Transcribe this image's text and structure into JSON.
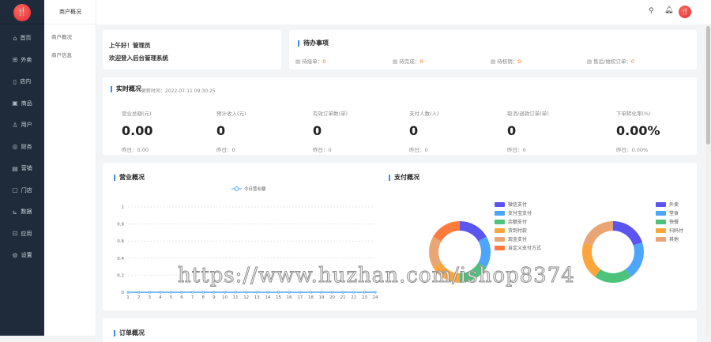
{
  "sidebar": {
    "logo": "🍴",
    "items": [
      {
        "icon": "⌂",
        "label": "首页"
      },
      {
        "icon": "⊞",
        "label": "外卖"
      },
      {
        "icon": "▯",
        "label": "店内"
      },
      {
        "icon": "▣",
        "label": "商品"
      },
      {
        "icon": "♙",
        "label": "用户"
      },
      {
        "icon": "◎",
        "label": "财务"
      },
      {
        "icon": "▤",
        "label": "营销"
      },
      {
        "icon": "▢",
        "label": "门店"
      },
      {
        "icon": "⊾",
        "label": "数据"
      },
      {
        "icon": "⊡",
        "label": "应用"
      },
      {
        "icon": "⚙",
        "label": "设置"
      }
    ]
  },
  "subnav": {
    "title": "商户概况",
    "items": [
      "商户概况",
      "商户信息"
    ]
  },
  "topbar": {
    "search_icon": "search",
    "bell_icon": "bell",
    "avatar": "🍴"
  },
  "greeting": {
    "line1": "上午好！管理员",
    "line2": "欢迎登入后台管理系统"
  },
  "todo": {
    "title": "待办事项",
    "items": [
      {
        "label": "待接单：",
        "value": "0"
      },
      {
        "label": "待完成：",
        "value": "0"
      },
      {
        "label": "待核销：",
        "value": "0"
      },
      {
        "label": "售后/维权订单：",
        "value": "0"
      }
    ]
  },
  "realtime": {
    "title": "实时概况",
    "update": "更新时间：2022-07-11 09:30:25",
    "stats": [
      {
        "label": "营业总额(元)",
        "value": "0.00",
        "sub": "昨日：0.00"
      },
      {
        "label": "预计收入(元)",
        "value": "0",
        "sub": "昨日：0"
      },
      {
        "label": "有效订单数(单)",
        "value": "0",
        "sub": "昨日：0"
      },
      {
        "label": "支付人数(人)",
        "value": "0",
        "sub": "昨日：0"
      },
      {
        "label": "取消/退款订单(单)",
        "value": "0",
        "sub": "昨日：0"
      },
      {
        "label": "下单转化率(%)",
        "value": "0.00%",
        "sub": "昨日：0.00%"
      }
    ]
  },
  "business": {
    "title": "营业概况"
  },
  "payment": {
    "title": "支付概况"
  },
  "orders": {
    "title": "订单概况"
  },
  "watermark": "https://www.huzhan.com/ishop8374",
  "chart_data": [
    {
      "type": "line",
      "title": "营业概况",
      "legend": [
        "今日营业额"
      ],
      "x": [
        1,
        2,
        3,
        4,
        5,
        6,
        7,
        8,
        9,
        10,
        11,
        12,
        13,
        14,
        15,
        16,
        17,
        18,
        19,
        20,
        21,
        22,
        23,
        24
      ],
      "series": [
        {
          "name": "今日营业额",
          "values": [
            0,
            0,
            0,
            0,
            0,
            0,
            0,
            0,
            0,
            0,
            0,
            0,
            0,
            0,
            0,
            0,
            0,
            0,
            0,
            0,
            0,
            0,
            0,
            0
          ]
        }
      ],
      "yticks": [
        "0",
        "0.2",
        "0.4",
        "0.6",
        "0.8",
        "1"
      ],
      "ylim": [
        0,
        1
      ],
      "color": "#4ea5fc"
    },
    {
      "type": "pie",
      "title": "支付方式",
      "categories": [
        "微信支付",
        "支付宝支付",
        "余额支付",
        "货到付款",
        "现金支付",
        "自定义支付方式"
      ],
      "values": [
        1,
        1,
        1,
        1,
        1,
        1
      ],
      "colors": [
        "#5a55f0",
        "#4ea5fc",
        "#4cc27a",
        "#fba53c",
        "#eaa574",
        "#ff7a3d"
      ]
    },
    {
      "type": "pie",
      "title": "订单类型",
      "categories": [
        "外卖",
        "堂食",
        "快餐",
        "扫码付",
        "其他"
      ],
      "values": [
        1,
        1,
        1,
        1,
        1
      ],
      "colors": [
        "#5a55f0",
        "#4ea5fc",
        "#4cc27a",
        "#fba53c",
        "#eaa574"
      ]
    }
  ]
}
